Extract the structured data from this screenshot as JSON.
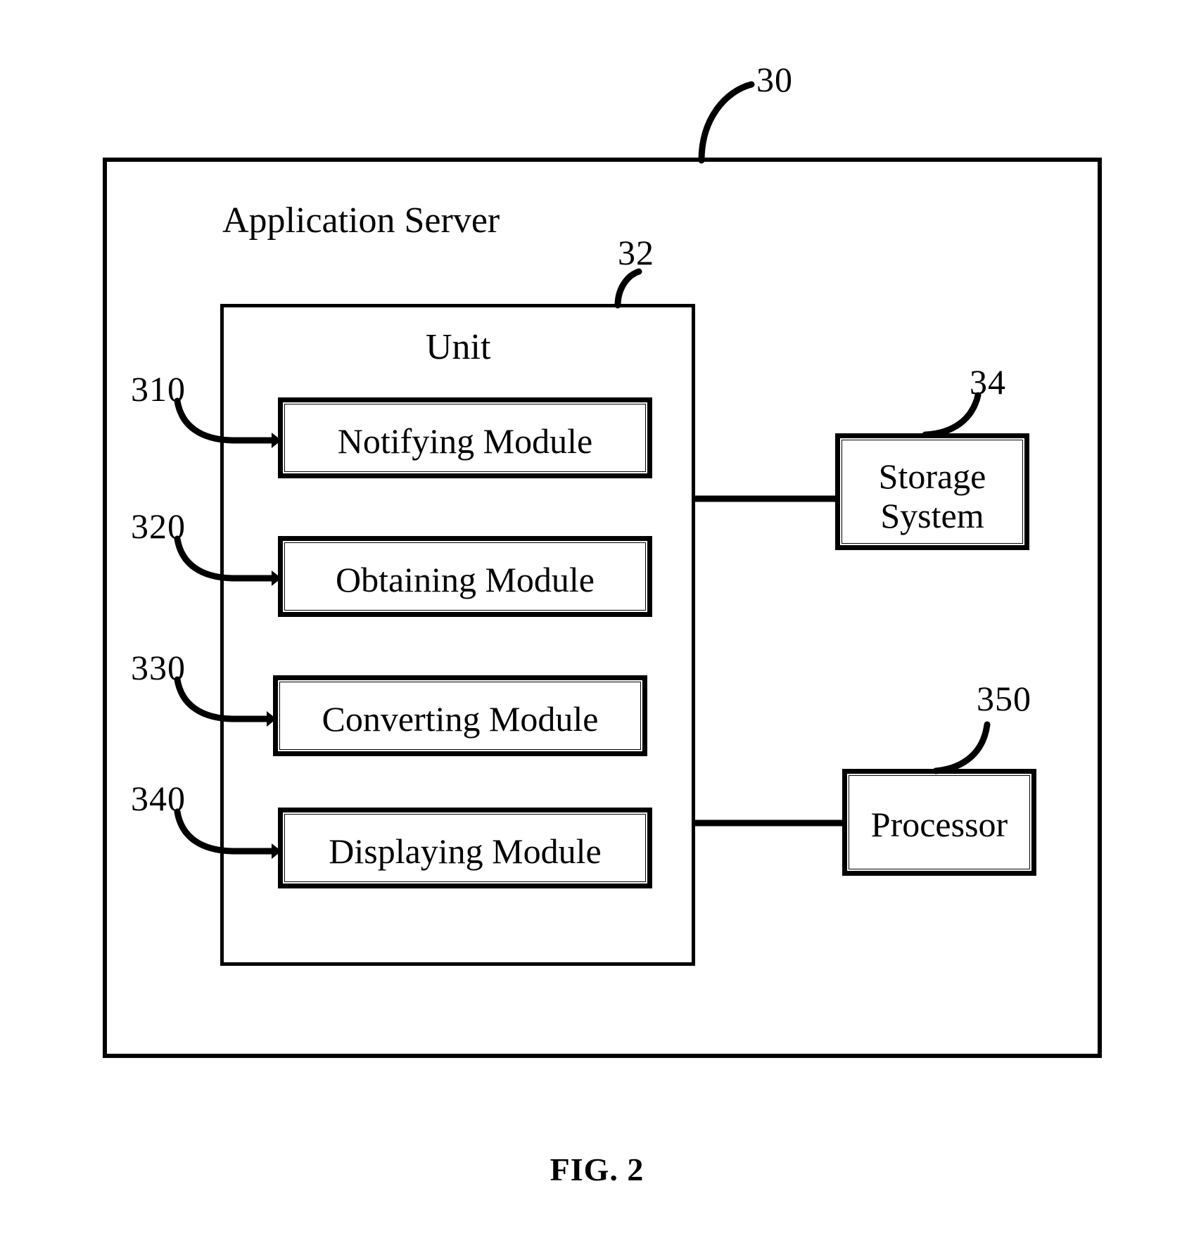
{
  "figure": {
    "caption": "FIG. 2",
    "outer": {
      "ref": "30",
      "title": "Application Server"
    },
    "unit": {
      "ref": "32",
      "title": "Unit"
    },
    "modules": [
      {
        "ref": "310",
        "label": "Notifying Module"
      },
      {
        "ref": "320",
        "label": "Obtaining Module"
      },
      {
        "ref": "330",
        "label": "Converting Module"
      },
      {
        "ref": "340",
        "label": "Displaying Module"
      }
    ],
    "side_blocks": [
      {
        "ref": "34",
        "label": "Storage\nSystem"
      },
      {
        "ref": "350",
        "label": "Processor"
      }
    ],
    "colors": {
      "ink": "#000000",
      "paper": "#ffffff"
    }
  }
}
